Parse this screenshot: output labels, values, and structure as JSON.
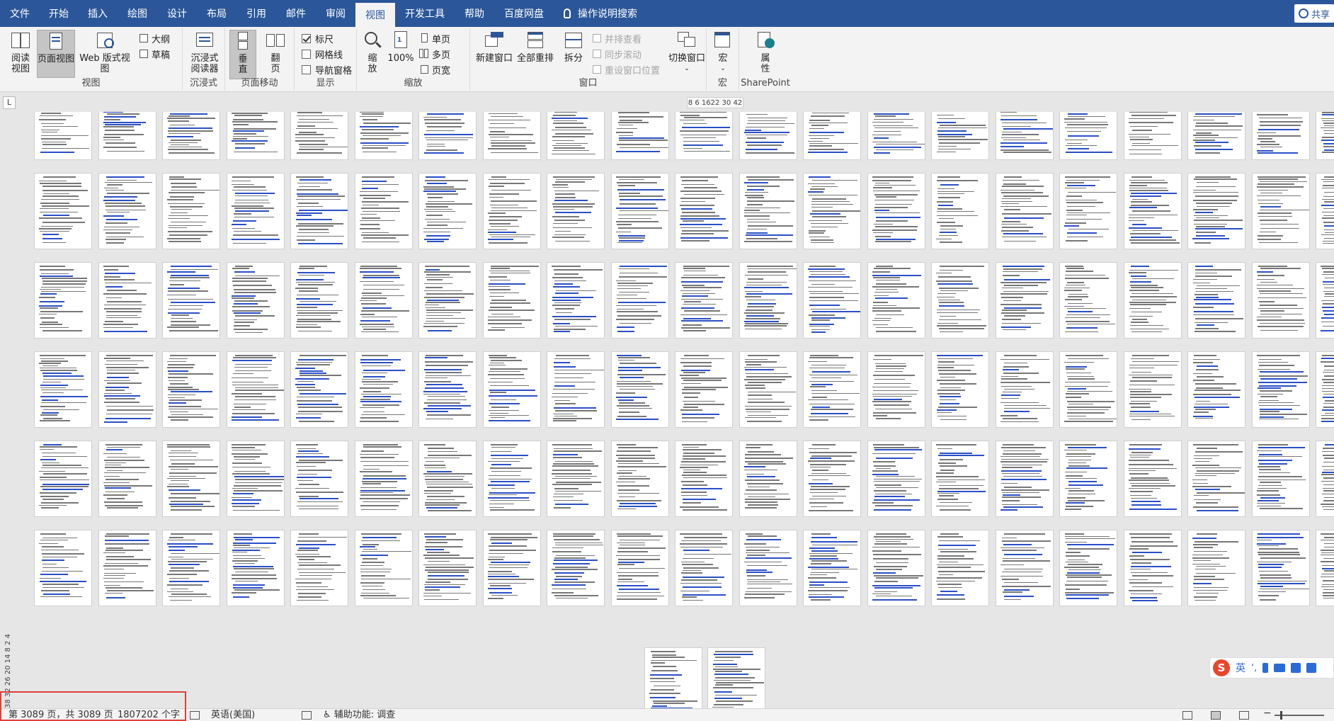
{
  "tabs": [
    "文件",
    "开始",
    "插入",
    "绘图",
    "设计",
    "布局",
    "引用",
    "邮件",
    "审阅",
    "视图",
    "开发工具",
    "帮助",
    "百度网盘",
    "操作说明搜索"
  ],
  "active_tab": "视图",
  "share_label": "共享",
  "ribbon": {
    "view": {
      "label": "视图",
      "read_mode": "阅读\n视图",
      "print_layout": "页面视图",
      "web_layout": "Web 版式视图",
      "outline": "大纲",
      "draft": "草稿"
    },
    "immersive": {
      "label": "沉浸式",
      "reader": "沉浸式\n阅读器"
    },
    "page_movement": {
      "label": "页面移动",
      "vertical": "垂\n直",
      "side": "翻\n页"
    },
    "show": {
      "label": "显示",
      "ruler": "标尺",
      "ruler_checked": true,
      "gridlines": "网格线",
      "gridlines_checked": false,
      "nav_pane": "导航窗格",
      "nav_checked": false
    },
    "zoom": {
      "label": "缩放",
      "zoom": "缩\n放",
      "hundred": "100%",
      "one_page": "单页",
      "multi_page": "多页",
      "page_width": "页宽"
    },
    "window": {
      "label": "窗口",
      "new_window": "新建窗口",
      "arrange_all": "全部重排",
      "split": "拆分",
      "side_by_side": "并排查看",
      "sync_scroll": "同步滚动",
      "reset_pos": "重设窗口位置",
      "switch": "切换窗口"
    },
    "macros": {
      "label": "宏",
      "macros": "宏"
    },
    "sharepoint": {
      "label": "SharePoint",
      "properties": "属\n性"
    }
  },
  "ruler_text": "8   6 1622 30  42",
  "tab_selector": "L",
  "vruler_text": "38 32 26 20 14  8  2  4",
  "ime": {
    "logo": "S",
    "lang": "英"
  },
  "status": {
    "page": "第 3089 页，共 3089 页",
    "words": "1807202 个字",
    "language": "英语(美国)",
    "accessibility": "辅助功能: 调查"
  }
}
